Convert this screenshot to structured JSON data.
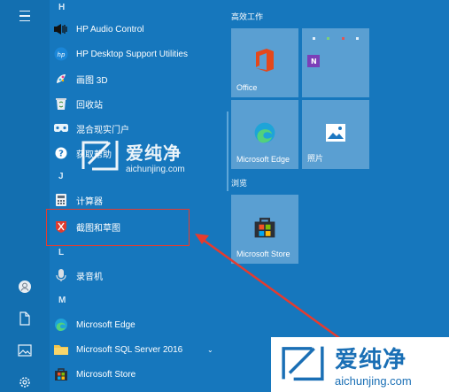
{
  "colors": {
    "background": "#1677bd",
    "tile": "#5a9fd2",
    "highlight": "#e63b2e",
    "watermark_blue": "#1a6fb5"
  },
  "rail": {
    "icons": [
      "hamburger-menu-icon",
      "user-icon",
      "document-icon",
      "pictures-icon",
      "settings-icon"
    ]
  },
  "app_list": {
    "letters": {
      "h": "H",
      "j": "J",
      "l": "L",
      "m": "M"
    },
    "apps": [
      {
        "label": "HP Audio Control",
        "icon": "hp-audio-icon"
      },
      {
        "label": "HP Desktop Support Utilities",
        "icon": "hp-logo-icon"
      },
      {
        "label": "画图 3D",
        "icon": "paint-3d-icon"
      },
      {
        "label": "回收站",
        "icon": "recycle-bin-icon"
      },
      {
        "label": "混合现实门户",
        "icon": "mixed-reality-icon"
      },
      {
        "label": "获取帮助",
        "icon": "get-help-icon"
      },
      {
        "label": "计算器",
        "icon": "calculator-icon"
      },
      {
        "label": "截图和草图",
        "icon": "snip-sketch-icon"
      },
      {
        "label": "录音机",
        "icon": "voice-recorder-icon"
      },
      {
        "label": "Microsoft Edge",
        "icon": "edge-icon"
      },
      {
        "label": "Microsoft SQL Server 2016",
        "icon": "folder-icon"
      },
      {
        "label": "Microsoft Store",
        "icon": "store-icon"
      }
    ]
  },
  "groups": {
    "work": "高效工作",
    "browse": "浏览"
  },
  "tiles": {
    "office": "Office",
    "edge": "Microsoft Edge",
    "photos": "照片",
    "store": "Microsoft Store"
  },
  "watermark": {
    "brand": "爱纯净",
    "url": "aichunjing.com"
  }
}
